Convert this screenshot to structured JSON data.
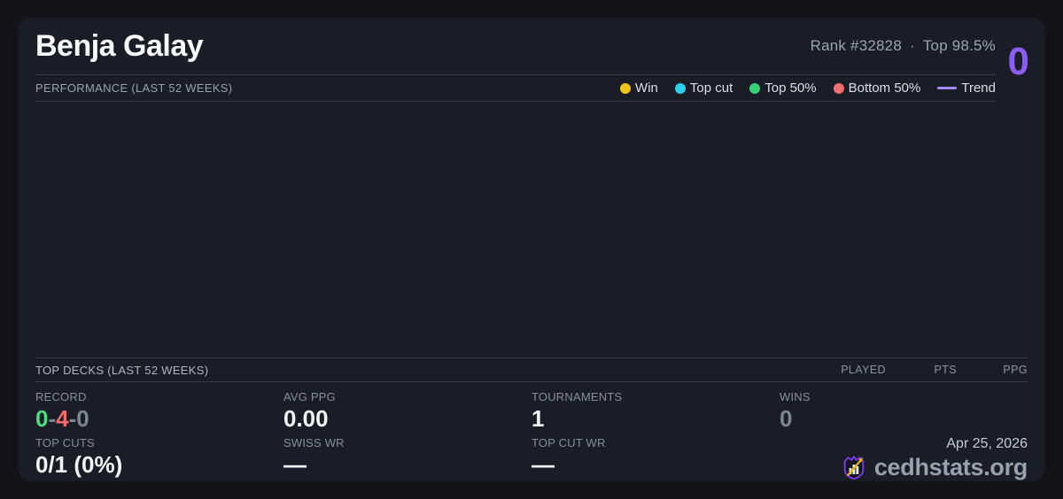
{
  "page": {
    "background": "#131318",
    "card_background": "#1a1d26"
  },
  "header": {
    "player_name": "Benja Galay",
    "rank_label": "Rank #32828",
    "separator": "·",
    "top_percent": "Top 98.5%",
    "score": "0",
    "score_color": "#8b5cf6"
  },
  "performance": {
    "title": "PERFORMANCE (LAST 52 WEEKS)",
    "legend": [
      {
        "label": "Win",
        "color": "#f0c419",
        "swatch": "dot"
      },
      {
        "label": "Top cut",
        "color": "#2bd2ee",
        "swatch": "dot"
      },
      {
        "label": "Top 50%",
        "color": "#38d077",
        "swatch": "dot"
      },
      {
        "label": "Bottom 50%",
        "color": "#f26d6d",
        "swatch": "dot"
      },
      {
        "label": "Trend",
        "color": "#a78bfa",
        "swatch": "line"
      }
    ]
  },
  "chart_data": {
    "type": "scatter",
    "title": "PERFORMANCE (LAST 52 WEEKS)",
    "x": [],
    "series": [],
    "plot_area_empty": true
  },
  "top_decks": {
    "title": "TOP DECKS (LAST 52 WEEKS)",
    "columns": [
      "PLAYED",
      "PTS",
      "PPG"
    ],
    "rows": []
  },
  "stats": {
    "record": {
      "label": "RECORD",
      "wins": "0",
      "losses": "4",
      "draws": "0",
      "separator": "-",
      "wins_color": "#4ade80",
      "losses_color": "#f56b6b",
      "draws_color": "#7d8492"
    },
    "avg_ppg": {
      "label": "AVG PPG",
      "value": "0.00"
    },
    "tournaments": {
      "label": "TOURNAMENTS",
      "value": "1"
    },
    "wins": {
      "label": "WINS",
      "value": "0"
    },
    "top_cuts": {
      "label": "TOP CUTS",
      "value": "0/1 (0%)"
    },
    "swiss_wr": {
      "label": "SWISS WR",
      "value": "—"
    },
    "top_cut_wr": {
      "label": "TOP CUT WR",
      "value": "—"
    }
  },
  "footer": {
    "date": "Apr 25, 2026",
    "brand": "cedhstats.org",
    "logo": "shield-bar-chart-arrow"
  }
}
